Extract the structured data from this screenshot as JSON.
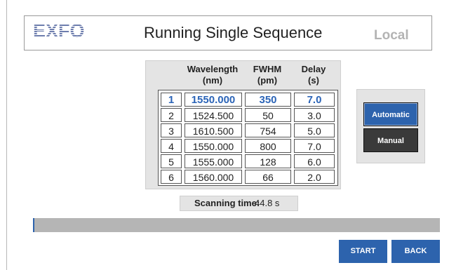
{
  "header": {
    "logo_text": "EXFO",
    "title": "Running Single Sequence",
    "mode_label": "Local"
  },
  "table": {
    "columns": [
      {
        "label": "Wavelength",
        "unit": "(nm)"
      },
      {
        "label": "FWHM",
        "unit": "(pm)"
      },
      {
        "label": "Delay",
        "unit": "(s)"
      }
    ],
    "rows": [
      {
        "index": "1",
        "wavelength": "1550.000",
        "fwhm": "350",
        "delay": "7.0",
        "selected": true
      },
      {
        "index": "2",
        "wavelength": "1524.500",
        "fwhm": "50",
        "delay": "3.0",
        "selected": false
      },
      {
        "index": "3",
        "wavelength": "1610.500",
        "fwhm": "754",
        "delay": "5.0",
        "selected": false
      },
      {
        "index": "4",
        "wavelength": "1550.000",
        "fwhm": "800",
        "delay": "7.0",
        "selected": false
      },
      {
        "index": "5",
        "wavelength": "1555.000",
        "fwhm": "128",
        "delay": "6.0",
        "selected": false
      },
      {
        "index": "6",
        "wavelength": "1560.000",
        "fwhm": "66",
        "delay": "2.0",
        "selected": false
      }
    ]
  },
  "scanning": {
    "label": "Scanning time:",
    "value": "44.8 s"
  },
  "mode_buttons": {
    "automatic": "Automatic",
    "manual": "Manual",
    "active": "automatic"
  },
  "progress": {
    "fraction": 0.004
  },
  "actions": {
    "start": "START",
    "back": "BACK"
  },
  "colors": {
    "accent": "#2d63ad",
    "selected_row_text": "#2b64b7",
    "panel_bg": "#e4e4e4",
    "progress_track": "#b5b5b5",
    "mode_label": "#b3b3b3",
    "manual_button": "#3a3a3a"
  }
}
